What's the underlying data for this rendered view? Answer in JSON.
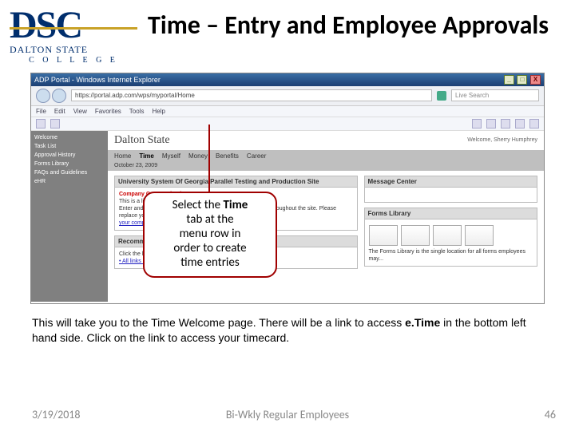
{
  "logo": {
    "initials": "DSC",
    "line1": "DALTON STATE",
    "line2": "C O L L E G E"
  },
  "title": "Time – Entry and Employee Approvals",
  "browser": {
    "window_title": "ADP Portal - Windows Internet Explorer",
    "url": "https://portal.adp.com/wps/myportal/Home",
    "search_placeholder": "Live Search",
    "menu": [
      "File",
      "Edit",
      "View",
      "Favorites",
      "Tools",
      "Help"
    ]
  },
  "portal": {
    "brand": "Dalton State",
    "welcome": "Welcome, Sherry Humphrey",
    "tabs": [
      "Home",
      "Time",
      "Myself",
      "Money",
      "Benefits",
      "Career"
    ],
    "active_tab": "Time",
    "date": "October 23, 2009",
    "left_nav": [
      "Welcome",
      "Task List",
      "Approval History",
      "Forms Library",
      "FAQs and Guidelines",
      "eHR"
    ],
    "panel_main_title": "University System Of Georgia Parallel Testing and Production Site",
    "panel_main_red": "Company Communications",
    "panel_main_text1": "This is a list of company news and any important content.",
    "panel_main_text2": "Enter and/or download the forms your users to see here and throughout the site. Please replace your institution page name, add the content text to",
    "panel_main_link": "your company's approved copy",
    "panel_reco_title": "Recommended Links",
    "panel_reco_text": "Click the link below to access all recommended",
    "panel_reco_link": "• All links >>",
    "panel_msg_title": "Message Center",
    "panel_forms_title": "Forms Library",
    "panel_forms_text": "The Forms Library is the single location for all forms employees may..."
  },
  "callout": {
    "l1": "Select the ",
    "l1b": "Time",
    "l2": "tab at the",
    "l3": "menu row in",
    "l4": "order to create",
    "l5": "time entries"
  },
  "caption": {
    "p1a": "This will take you to the Time Welcome page. There will be a link to access ",
    "p1b": "e.Time",
    "p1c": " in the bottom left hand side. Click on the link to access your timecard."
  },
  "footer": {
    "date": "3/19/2018",
    "center": "Bi-Wkly Regular Employees",
    "page": "46"
  }
}
